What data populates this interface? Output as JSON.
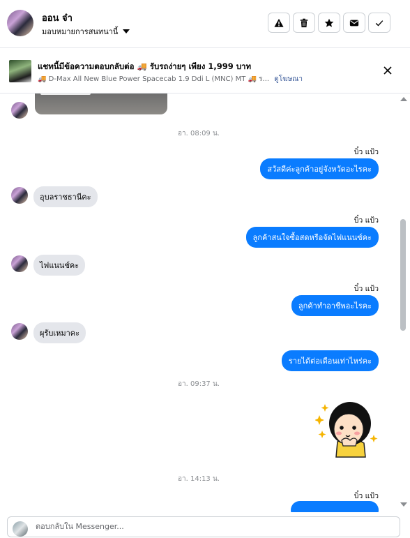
{
  "header": {
    "name": "ออน จ๋า",
    "assign_label": "มอบหมายการสนทนานี้",
    "actions": [
      "report-icon",
      "trash-icon",
      "star-icon",
      "mail-icon",
      "check-icon"
    ]
  },
  "banner": {
    "title": "แชทนี้มีข้อความตอบกลับต่อ 🚚 รับรถง่ายๆ เพียง 1,999 บาท",
    "subtitle": "🚚 D-Max All New Blue Power Spacecab 1.9 Ddi L (MNC) MT 🚚 ร...",
    "link": "ดูโฆษณา"
  },
  "messages": {
    "ts1": "อา. 08:09 น.",
    "sender1": "บิ๋ว แป้ว",
    "out1": "สวัสดีค่ะลูกค้าอยู่จังหวัดอะไรคะ",
    "in1": "อุบลราชธานีคะ",
    "sender2": "บิ๋ว แป้ว",
    "out2": "ลูกค้าสนใจซื้อสดหรือจัดไฟแนนซ์คะ",
    "in2": "ไฟแนนช์คะ",
    "sender3": "บิ๋ว แป้ว",
    "out3": "ลูกค้าทำอาชีพอะไรคะ",
    "in3": "ผุรับเหมาคะ",
    "out4": "รายได้ต่อเดือนเท่าไหร่คะ",
    "ts2": "อา. 09:37 น.",
    "ts3": "อา. 14:13 น.",
    "sender4": "บิ๋ว แป้ว"
  },
  "composer": {
    "placeholder": "ตอบกลับใน Messenger..."
  },
  "colors": {
    "outgoing": "#0a7cff",
    "incoming": "#e4e6eb"
  }
}
